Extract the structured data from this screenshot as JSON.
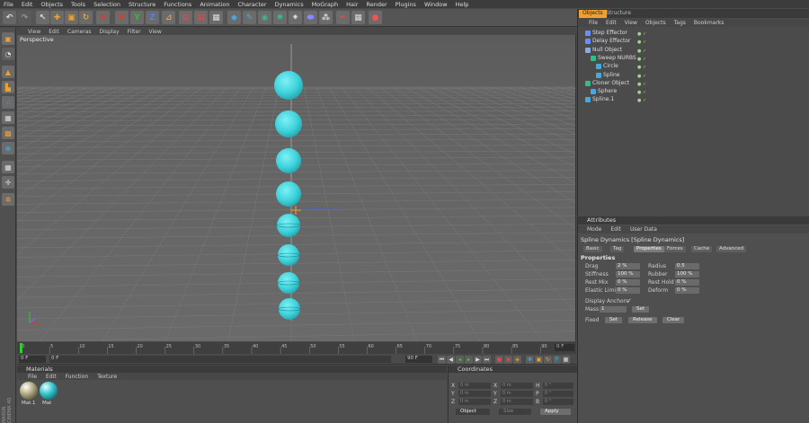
{
  "menubar": [
    "File",
    "Edit",
    "Objects",
    "Tools",
    "Selection",
    "Structure",
    "Functions",
    "Animation",
    "Character",
    "Dynamics",
    "MoGraph",
    "Hair",
    "Render",
    "Plugins",
    "Window",
    "Help"
  ],
  "viewport": {
    "menu": [
      "View",
      "Edit",
      "Cameras",
      "Display",
      "Filter",
      "View"
    ],
    "label": "Perspective"
  },
  "timeline": {
    "ticks": [
      "0",
      "5",
      "10",
      "15",
      "20",
      "25",
      "30",
      "35",
      "40",
      "45",
      "50",
      "55",
      "60",
      "65",
      "70",
      "75",
      "80",
      "85",
      "90"
    ],
    "end_frame": "0 F",
    "current_frame": "0 F",
    "min_frame": "0 F",
    "max_frame": "90 F"
  },
  "materials": {
    "title": "Materials",
    "menu": [
      "File",
      "Edit",
      "Function",
      "Texture"
    ],
    "items": [
      {
        "name": "Mat.1",
        "color": "#a8a080"
      },
      {
        "name": "Mat",
        "color": "#39c8d0"
      }
    ]
  },
  "coordinates": {
    "title": "Coordinates",
    "x": {
      "pos": "0 m",
      "size": "0 m",
      "rot": "0 °"
    },
    "y": {
      "pos": "0 m",
      "size": "0 m",
      "rot": "0 °"
    },
    "z": {
      "pos": "0 m",
      "size": "0 m",
      "rot": "0 °"
    },
    "pos_label": "X",
    "size_label": "X",
    "rot_label": "H",
    "mode": "Object",
    "size_mode": "Size",
    "apply": "Apply"
  },
  "brand": "MAXON CINEMA 4D",
  "object_manager": {
    "tabs": [
      "Objects",
      "Structure"
    ],
    "menu": [
      "File",
      "Edit",
      "View",
      "Objects",
      "Tags",
      "Bookmarks"
    ],
    "rows": [
      {
        "name": "Step Effector",
        "indent": 0
      },
      {
        "name": "Delay Effector",
        "indent": 0
      },
      {
        "name": "Null Object",
        "indent": 0
      },
      {
        "name": "Sweep NURBS",
        "indent": 1
      },
      {
        "name": "Circle",
        "indent": 2
      },
      {
        "name": "Spline",
        "indent": 2
      },
      {
        "name": "Cloner Object",
        "indent": 0
      },
      {
        "name": "Sphere",
        "indent": 1
      },
      {
        "name": "Spline.1",
        "indent": 0
      }
    ]
  },
  "attributes": {
    "title": "Attributes",
    "menu": [
      "Mode",
      "Edit",
      "User Data"
    ],
    "object": "Spline Dynamics [Spline Dynamics]",
    "tabs": [
      "Basic",
      "Tag",
      "Properties",
      "Forces",
      "Cache",
      "Advanced"
    ],
    "active_tab": "Properties",
    "section": "Properties",
    "props": {
      "drag": {
        "label": "Drag",
        "value": "2 %"
      },
      "radius": {
        "label": "Radius",
        "value": "0.5"
      },
      "stiffness": {
        "label": "Stiffness",
        "value": "100 %"
      },
      "rubber": {
        "label": "Rubber",
        "value": "100 %"
      },
      "rest_mix": {
        "label": "Rest Mix",
        "value": "0 %"
      },
      "rest_hold": {
        "label": "Rest Hold",
        "value": "0 %"
      },
      "elastic_limit": {
        "label": "Elastic Limit",
        "value": "0 %"
      },
      "deform": {
        "label": "Deform",
        "value": "0 %"
      }
    },
    "display_anchors": "Display Anchors",
    "mass": {
      "label": "Mass",
      "value": "1",
      "button": "Set"
    },
    "fixed": {
      "label": "Fixed",
      "set": "Set",
      "release": "Release",
      "clear": "Clear"
    }
  },
  "colors": {
    "sphere": "#3fd3dc",
    "accent": "#f0a030"
  }
}
